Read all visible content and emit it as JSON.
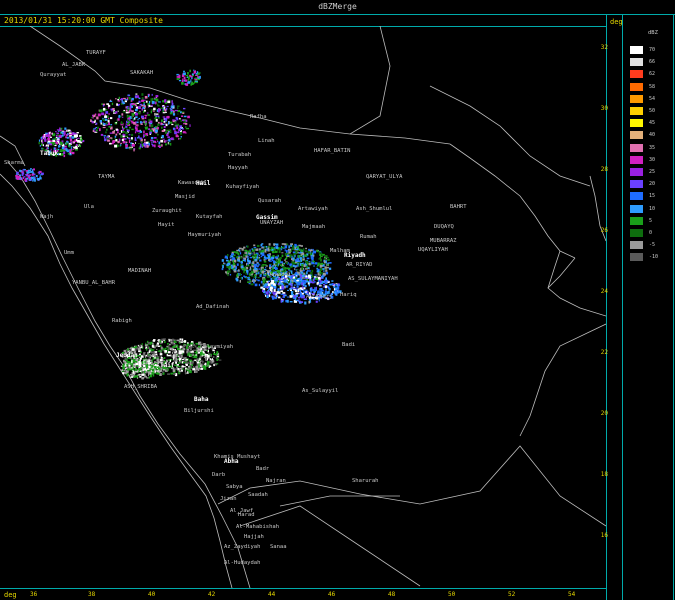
{
  "window": {
    "title": "dBZMerge"
  },
  "header": {
    "timestamp": "2013/01/31 15:20:00 GMT Composite"
  },
  "axes": {
    "lat_unit": "deg",
    "lon_unit": "deg",
    "lat_ticks": [
      "32",
      "30",
      "28",
      "26",
      "24",
      "22",
      "20",
      "18",
      "16"
    ],
    "lon_ticks": [
      "36",
      "38",
      "40",
      "42",
      "44",
      "46",
      "48",
      "50",
      "52",
      "54"
    ]
  },
  "legend": {
    "title": "dBZ",
    "entries": [
      {
        "label": "70",
        "color": "#ffffff"
      },
      {
        "label": "66",
        "color": "#e0e0e0"
      },
      {
        "label": "62",
        "color": "#ff3c1e"
      },
      {
        "label": "58",
        "color": "#ff6a00"
      },
      {
        "label": "54",
        "color": "#ff9a00"
      },
      {
        "label": "50",
        "color": "#ffd000"
      },
      {
        "label": "45",
        "color": "#fff700"
      },
      {
        "label": "40",
        "color": "#e3b07a"
      },
      {
        "label": "35",
        "color": "#e070b0"
      },
      {
        "label": "30",
        "color": "#d020c0"
      },
      {
        "label": "25",
        "color": "#9a20e0"
      },
      {
        "label": "20",
        "color": "#6a40ff"
      },
      {
        "label": "15",
        "color": "#1e6cff"
      },
      {
        "label": "10",
        "color": "#2e9cff"
      },
      {
        "label": "5",
        "color": "#1aa01a"
      },
      {
        "label": "0",
        "color": "#0e6e0e"
      },
      {
        "label": "-5",
        "color": "#9a9a9a"
      },
      {
        "label": "-10",
        "color": "#5a5a5a"
      }
    ]
  },
  "places": [
    {
      "name": "TURAYF",
      "major": false
    },
    {
      "name": "AL_JABK",
      "major": false
    },
    {
      "name": "Qurayyat",
      "major": false
    },
    {
      "name": "SAKAKAH",
      "major": false
    },
    {
      "name": "Tabuk",
      "major": true
    },
    {
      "name": "Sharma",
      "major": false
    },
    {
      "name": "TAYMA",
      "major": false
    },
    {
      "name": "Rafha",
      "major": false
    },
    {
      "name": "Linah",
      "major": false
    },
    {
      "name": "HAFAR_BATIN",
      "major": false
    },
    {
      "name": "Turabah",
      "major": false
    },
    {
      "name": "Hayyah",
      "major": false
    },
    {
      "name": "QARYAT_ULYA",
      "major": false
    },
    {
      "name": "Kawasdah",
      "major": false
    },
    {
      "name": "Hail",
      "major": true
    },
    {
      "name": "Kuhayfiyah",
      "major": false
    },
    {
      "name": "Masjid",
      "major": false
    },
    {
      "name": "Qusarah",
      "major": false
    },
    {
      "name": "Ula",
      "major": false
    },
    {
      "name": "Zuraughit",
      "major": false
    },
    {
      "name": "Kutayfah",
      "major": false
    },
    {
      "name": "Gassim",
      "major": true
    },
    {
      "name": "Artawiyah",
      "major": false
    },
    {
      "name": "Ash_Shumlul",
      "major": false
    },
    {
      "name": "BAHRT",
      "major": false
    },
    {
      "name": "Wajh",
      "major": false
    },
    {
      "name": "Hayit",
      "major": false
    },
    {
      "name": "UNAYZAH",
      "major": false
    },
    {
      "name": "Majmaah",
      "major": false
    },
    {
      "name": "Haymuriyah",
      "major": false
    },
    {
      "name": "DUQAYQ",
      "major": false
    },
    {
      "name": "Rumah",
      "major": false
    },
    {
      "name": "MUBARRAZ",
      "major": false
    },
    {
      "name": "UQAYLIYAH",
      "major": false
    },
    {
      "name": "Umm",
      "major": false
    },
    {
      "name": "Malham",
      "major": false
    },
    {
      "name": "Riyadh",
      "major": true
    },
    {
      "name": "AR_RIYAD",
      "major": false
    },
    {
      "name": "MADINAH",
      "major": false
    },
    {
      "name": "Dawadmi",
      "major": false
    },
    {
      "name": "AS_SULAYMANIYAH",
      "major": false
    },
    {
      "name": "YANBU_AL_BAHR",
      "major": false
    },
    {
      "name": "Al_Kharj",
      "major": false
    },
    {
      "name": "Hariq",
      "major": false
    },
    {
      "name": "Ad_Dafinah",
      "major": false
    },
    {
      "name": "Rabigh",
      "major": false
    },
    {
      "name": "Badi",
      "major": false
    },
    {
      "name": "Sulaymiyah",
      "major": false
    },
    {
      "name": "Jeddah",
      "major": true
    },
    {
      "name": "Taif",
      "major": true
    },
    {
      "name": "ASH_SHRIBA",
      "major": false
    },
    {
      "name": "Baha",
      "major": true
    },
    {
      "name": "As_Sulayyil",
      "major": false
    },
    {
      "name": "Biljurshi",
      "major": false
    },
    {
      "name": "Khamis_Mushayt",
      "major": false
    },
    {
      "name": "Abha",
      "major": true
    },
    {
      "name": "Badr",
      "major": false
    },
    {
      "name": "Najran",
      "major": false
    },
    {
      "name": "Darb",
      "major": false
    },
    {
      "name": "Sabya",
      "major": false
    },
    {
      "name": "Sharurah",
      "major": false
    },
    {
      "name": "Jizan",
      "major": false
    },
    {
      "name": "Saadah",
      "major": false
    },
    {
      "name": "Al_Jawf",
      "major": false
    },
    {
      "name": "Harad",
      "major": false
    },
    {
      "name": "Al-Mahabishah",
      "major": false
    },
    {
      "name": "Hajjah",
      "major": false
    },
    {
      "name": "Az_Zaydiyah",
      "major": false
    },
    {
      "name": "Sanaa",
      "major": false
    },
    {
      "name": "Al-Hudaydah",
      "major": false
    }
  ]
}
